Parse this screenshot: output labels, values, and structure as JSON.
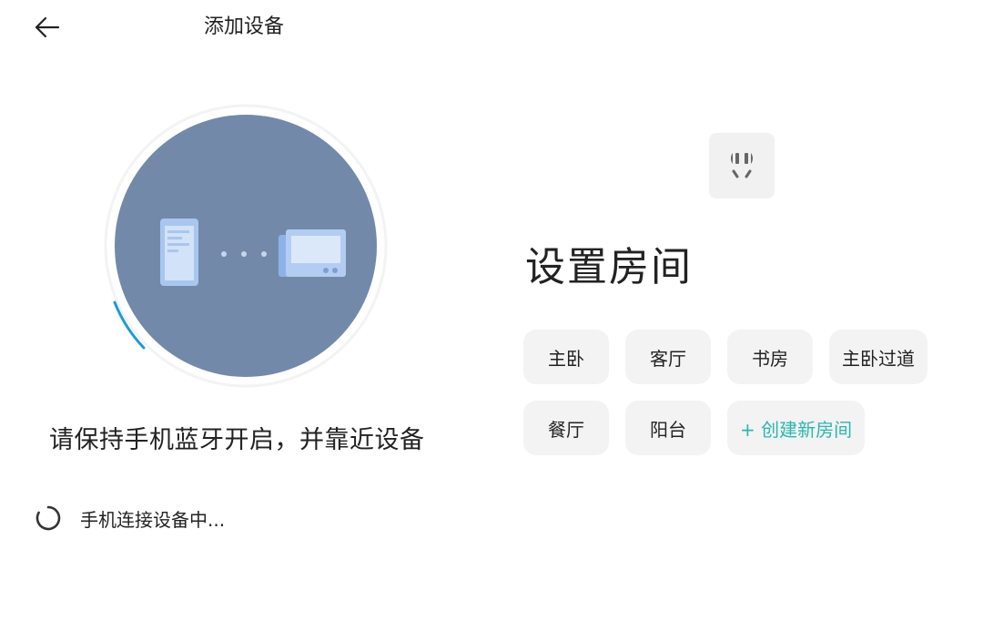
{
  "header": {
    "back_icon": "arrow-left-icon",
    "title": "添加设备"
  },
  "left": {
    "illustration": {
      "circle_color": "#7389aa",
      "progress_color": "#1e9ad6",
      "phone_icon": "phone-icon",
      "device_icon": "device-icon"
    },
    "instruction": "请保持手机蓝牙开启，并靠近设备",
    "status": {
      "spinner_icon": "loading-spinner-icon",
      "text": "手机连接设备中..."
    }
  },
  "right": {
    "device_icon": "power-plug-icon",
    "section_title": "设置房间",
    "rooms": [
      "主卧",
      "客厅",
      "书房",
      "主卧过道",
      "餐厅",
      "阳台"
    ],
    "create_room_label": "+ 创建新房间",
    "accent_color": "#2bb6b0"
  }
}
